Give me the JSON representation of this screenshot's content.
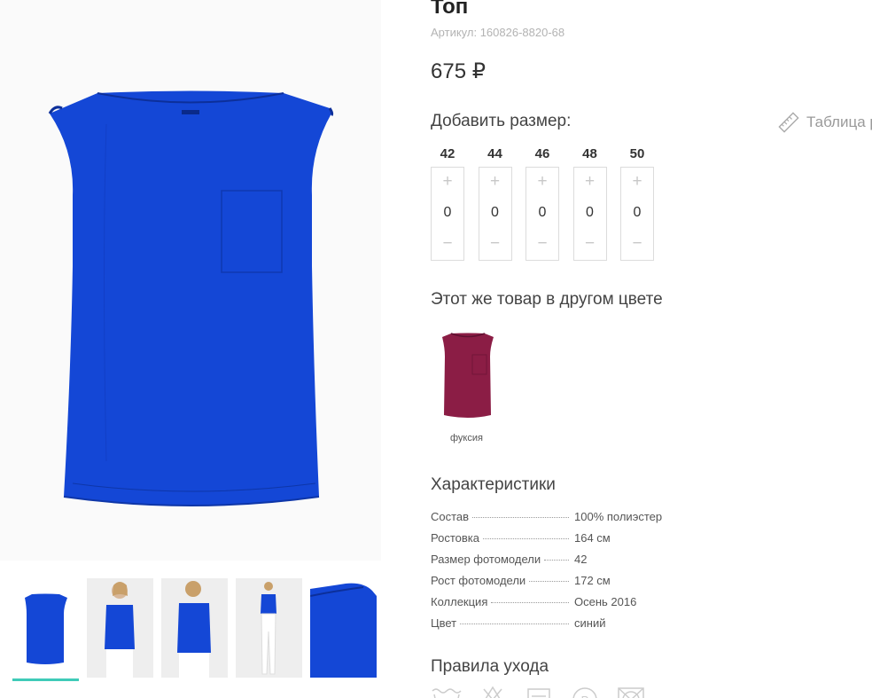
{
  "product": {
    "title": "Топ",
    "sku": "Артикул: 160826-8820-68",
    "price": "675 ₽"
  },
  "sizes": {
    "label": "Добавить размер:",
    "table_link": "Таблица р",
    "plus": "+",
    "minus": "−",
    "items": [
      {
        "size": "42",
        "qty": "0"
      },
      {
        "size": "44",
        "qty": "0"
      },
      {
        "size": "46",
        "qty": "0"
      },
      {
        "size": "48",
        "qty": "0"
      },
      {
        "size": "50",
        "qty": "0"
      }
    ]
  },
  "colors": {
    "heading": "Этот же товар в другом цвете",
    "options": [
      {
        "name": "фуксия",
        "swatch": "#8b1d45"
      }
    ]
  },
  "characteristics": {
    "heading": "Характеристики",
    "rows": [
      {
        "key": "Состав",
        "value": "100% полиэстер"
      },
      {
        "key": "Ростовка",
        "value": "164 см"
      },
      {
        "key": "Размер фотомодели",
        "value": "42"
      },
      {
        "key": "Рост фотомодели",
        "value": "172 см"
      },
      {
        "key": "Коллекция",
        "value": "Осень 2016"
      },
      {
        "key": "Цвет",
        "value": "синий"
      }
    ]
  },
  "care": {
    "heading": "Правила ухода",
    "icons": [
      "washing-icon",
      "no-bleach-icon",
      "drying-icon",
      "ironing-icon",
      "no-tumble-dry-icon"
    ]
  },
  "gallery": {
    "thumbnails": [
      "front-thumb",
      "model-front-thumb",
      "model-back-thumb",
      "model-full-thumb",
      "detail-thumb"
    ],
    "active_index": 0
  },
  "colors_palette": {
    "product_blue": "#1447d6",
    "accent_teal": "#3fcbb8",
    "fuchsia": "#8b1d45"
  }
}
